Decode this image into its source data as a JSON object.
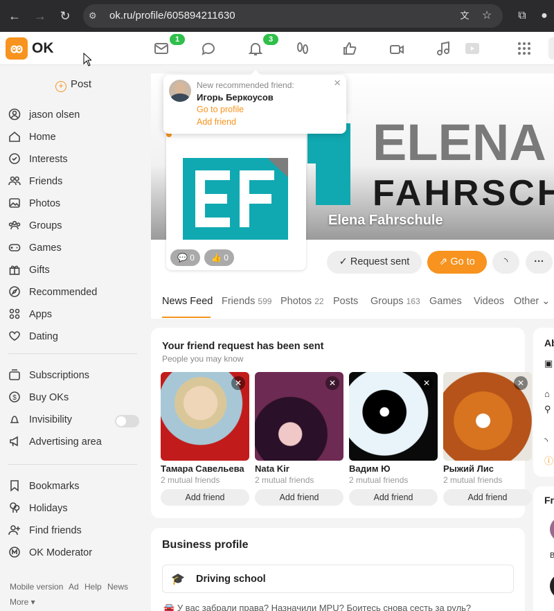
{
  "browser": {
    "url": "ok.ru/profile/605894211630"
  },
  "header": {
    "logo_text": "OK",
    "messages_badge": "1",
    "notifications_badge": "3",
    "accent": "#f7931e",
    "badge_color": "#2fbf4a"
  },
  "sidebar": {
    "post_label": "Post",
    "items": [
      {
        "label": "jason olsen",
        "icon": "user-icon"
      },
      {
        "label": "Home",
        "icon": "home-icon"
      },
      {
        "label": "Interests",
        "icon": "interests-icon"
      },
      {
        "label": "Friends",
        "icon": "friends-icon"
      },
      {
        "label": "Photos",
        "icon": "photos-icon"
      },
      {
        "label": "Groups",
        "icon": "groups-icon"
      },
      {
        "label": "Games",
        "icon": "gamepad-icon"
      },
      {
        "label": "Gifts",
        "icon": "gift-icon"
      },
      {
        "label": "Recommended",
        "icon": "compass-icon"
      },
      {
        "label": "Apps",
        "icon": "apps-icon"
      },
      {
        "label": "Dating",
        "icon": "hearts-icon"
      }
    ],
    "items2": [
      {
        "label": "Subscriptions",
        "icon": "subscriptions-icon"
      },
      {
        "label": "Buy OKs",
        "icon": "coin-icon"
      },
      {
        "label": "Invisibility",
        "icon": "invisibility-icon"
      },
      {
        "label": "Advertising area",
        "icon": "megaphone-icon"
      }
    ],
    "items3": [
      {
        "label": "Bookmarks",
        "icon": "bookmark-icon"
      },
      {
        "label": "Holidays",
        "icon": "balloons-icon"
      },
      {
        "label": "Find friends",
        "icon": "add-user-icon"
      },
      {
        "label": "OK Moderator",
        "icon": "moderator-icon"
      }
    ],
    "footer": {
      "mobile": "Mobile version",
      "ad": "Ad",
      "help": "Help",
      "news": "News",
      "more": "More"
    }
  },
  "popup": {
    "title": "New recommended friend:",
    "name": "Игорь Беркоусов",
    "go_to_profile": "Go to profile",
    "add_friend": "Add friend"
  },
  "profile": {
    "name": "Elena Fahrschule",
    "cover_line1": "ELENA",
    "cover_line2": "FAHRSCHU",
    "logo_letters": "EF",
    "comments": "0",
    "likes": "0",
    "request_sent": "Request sent",
    "go_to": "Go to"
  },
  "tabs": [
    {
      "label": "News Feed",
      "count": ""
    },
    {
      "label": "Friends",
      "count": "599"
    },
    {
      "label": "Photos",
      "count": "22"
    },
    {
      "label": "Posts",
      "count": ""
    },
    {
      "label": "Groups",
      "count": "163"
    },
    {
      "label": "Games",
      "count": ""
    },
    {
      "label": "Videos",
      "count": ""
    },
    {
      "label": "Other",
      "count": ""
    }
  ],
  "friend_request": {
    "title": "Your friend request has been sent",
    "subtitle": "People you may know",
    "suggestions": [
      {
        "name": "Тамара Савельева",
        "mutual": "2 mutual friends",
        "button": "Add friend"
      },
      {
        "name": "Nata Kir",
        "mutual": "2 mutual friends",
        "button": "Add friend"
      },
      {
        "name": "Вадим Ю",
        "mutual": "2 mutual friends",
        "button": "Add friend"
      },
      {
        "name": "Рыжий Лис",
        "mutual": "2 mutual friends",
        "button": "Add friend"
      }
    ]
  },
  "business": {
    "title": "Business profile",
    "category": "Driving school",
    "teaser": "У вас забрали права? Назначили MPU? Боитесь снова сесть за руль?"
  },
  "right_panel": {
    "about_prefix": "Ab",
    "friends_prefix": "Fr",
    "friend_initial": "B"
  }
}
